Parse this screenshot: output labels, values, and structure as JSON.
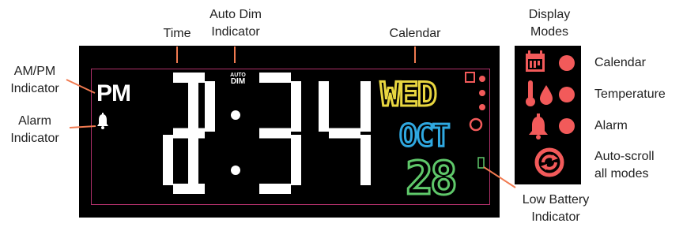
{
  "labels": {
    "time": "Time",
    "auto_dim": [
      "Auto Dim",
      "Indicator"
    ],
    "calendar": "Calendar",
    "display_modes": [
      "Display",
      "Modes"
    ],
    "am_pm": [
      "AM/PM",
      "Indicator"
    ],
    "alarm": [
      "Alarm",
      "Indicator"
    ],
    "low_battery": [
      "Low Battery",
      "Indicator"
    ],
    "modes": {
      "calendar": "Calendar",
      "temperature": "Temperature",
      "alarm": "Alarm",
      "auto_scroll": [
        "Auto-scroll",
        "all modes"
      ]
    }
  },
  "display": {
    "period": "PM",
    "auto_top": "AUTO",
    "auto_dim": "DIM",
    "time_digits": [
      "1",
      "2",
      "3",
      "4"
    ],
    "weekday": "WED",
    "month": "OCT",
    "day": "28"
  },
  "colors": {
    "callout": "#f07a50",
    "lcd_frame": "#b0306a",
    "weekday": "#e8d640",
    "month": "#2fa8e0",
    "day": "#5fc86a",
    "indicator_red": "#f25a5a",
    "battery": "#5fc86a"
  },
  "icons": [
    "calendar-icon",
    "thermometer-icon",
    "droplet-icon",
    "bell-icon",
    "auto-scroll-icon",
    "battery-icon"
  ]
}
